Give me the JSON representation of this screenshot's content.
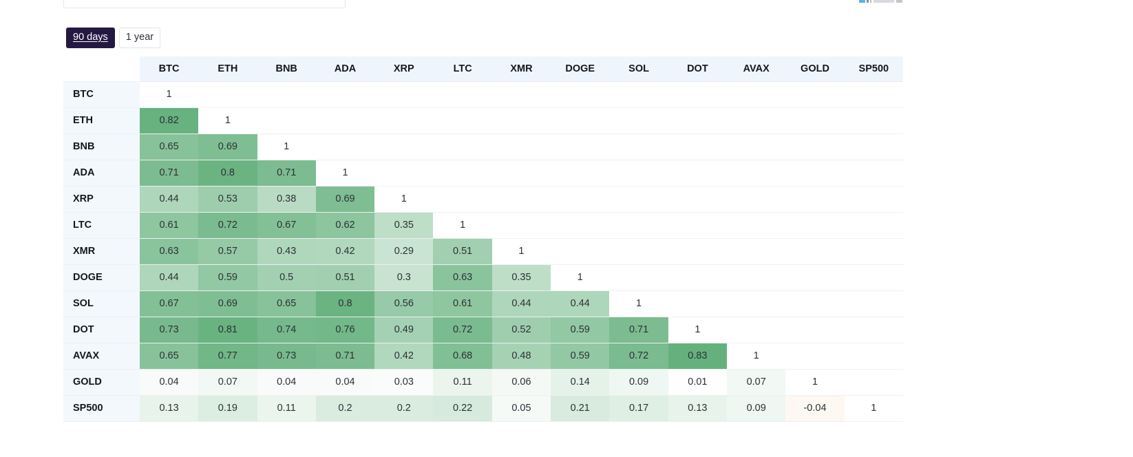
{
  "range_toggle": {
    "name": "time-range-toggle",
    "options": [
      {
        "label": "90 days",
        "active": true
      },
      {
        "label": "1 year",
        "active": false
      }
    ]
  },
  "theme": {
    "active_button_bg": "#231942",
    "active_button_fg": "#ffffff",
    "header_bg": "#eff5fc",
    "rowlabel_bg": "#f3f8fd",
    "positive_color": "#46a163",
    "negative_color": "#e8a33d",
    "diagonal_text": "#c2c6cb",
    "grid_line": "#edf0f2"
  },
  "chart_data": {
    "type": "heatmap",
    "title": "",
    "subtitle": "",
    "xlabel": "",
    "ylabel": "",
    "grid": true,
    "legend_position": "none",
    "value_range": [
      -0.04,
      1
    ],
    "colorscale": "white-to-green for positive, white-to-orange for negative",
    "diagonal_label": "1",
    "categories": [
      "BTC",
      "ETH",
      "BNB",
      "ADA",
      "XRP",
      "LTC",
      "XMR",
      "DOGE",
      "SOL",
      "DOT",
      "AVAX",
      "GOLD",
      "SP500"
    ],
    "x": [
      "BTC",
      "ETH",
      "BNB",
      "ADA",
      "XRP",
      "LTC",
      "XMR",
      "DOGE",
      "SOL",
      "DOT",
      "AVAX",
      "GOLD",
      "SP500"
    ],
    "y": [
      "BTC",
      "ETH",
      "BNB",
      "ADA",
      "XRP",
      "LTC",
      "XMR",
      "DOGE",
      "SOL",
      "DOT",
      "AVAX",
      "GOLD",
      "SP500"
    ],
    "lower_triangle_only": true,
    "z": [
      [
        1,
        null,
        null,
        null,
        null,
        null,
        null,
        null,
        null,
        null,
        null,
        null,
        null
      ],
      [
        0.82,
        1,
        null,
        null,
        null,
        null,
        null,
        null,
        null,
        null,
        null,
        null,
        null
      ],
      [
        0.65,
        0.69,
        1,
        null,
        null,
        null,
        null,
        null,
        null,
        null,
        null,
        null,
        null
      ],
      [
        0.71,
        0.8,
        0.71,
        1,
        null,
        null,
        null,
        null,
        null,
        null,
        null,
        null,
        null
      ],
      [
        0.44,
        0.53,
        0.38,
        0.69,
        1,
        null,
        null,
        null,
        null,
        null,
        null,
        null,
        null
      ],
      [
        0.61,
        0.72,
        0.67,
        0.62,
        0.35,
        1,
        null,
        null,
        null,
        null,
        null,
        null,
        null
      ],
      [
        0.63,
        0.57,
        0.43,
        0.42,
        0.29,
        0.51,
        1,
        null,
        null,
        null,
        null,
        null,
        null
      ],
      [
        0.44,
        0.59,
        0.5,
        0.51,
        0.3,
        0.63,
        0.35,
        1,
        null,
        null,
        null,
        null,
        null
      ],
      [
        0.67,
        0.69,
        0.65,
        0.8,
        0.56,
        0.61,
        0.44,
        0.44,
        1,
        null,
        null,
        null,
        null
      ],
      [
        0.73,
        0.81,
        0.74,
        0.76,
        0.49,
        0.72,
        0.52,
        0.59,
        0.71,
        1,
        null,
        null,
        null
      ],
      [
        0.65,
        0.77,
        0.73,
        0.71,
        0.42,
        0.68,
        0.48,
        0.59,
        0.72,
        0.83,
        1,
        null,
        null
      ],
      [
        0.04,
        0.07,
        0.04,
        0.04,
        0.03,
        0.11,
        0.06,
        0.14,
        0.09,
        0.01,
        0.07,
        1,
        null
      ],
      [
        0.13,
        0.19,
        0.11,
        0.2,
        0.2,
        0.22,
        0.05,
        0.21,
        0.17,
        0.13,
        0.09,
        -0.04,
        1
      ]
    ],
    "bold_cells": [
      [
        12,
        0
      ]
    ]
  }
}
